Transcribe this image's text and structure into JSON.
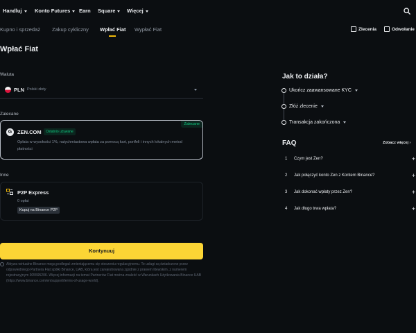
{
  "top_nav": {
    "items": [
      {
        "label": "Handluj",
        "has_caret": true
      },
      {
        "label": "Konto Futures",
        "has_caret": true
      },
      {
        "label": "Earn",
        "has_caret": false
      },
      {
        "label": "Square",
        "has_caret": true
      },
      {
        "label": "Więcej",
        "has_caret": true
      }
    ],
    "search_icon": "search-icon"
  },
  "sub_nav": {
    "tabs": [
      {
        "label": "Kupno i sprzedaż",
        "active": false
      },
      {
        "label": "Zakup cykliczny",
        "active": false
      },
      {
        "label": "Wpłać Fiat",
        "active": true
      },
      {
        "label": "Wypłać Fiat",
        "active": false
      }
    ],
    "orders_label": "Zlecenia",
    "refunds_label": "Odwołanie"
  },
  "page_title": "Wpłać Fiat",
  "currency_section": {
    "label": "Waluta",
    "selected_code": "PLN",
    "selected_name": "Polski złoty"
  },
  "recommended": {
    "label": "Zalecane",
    "name": "ZEN.COM",
    "badge": "Ostatnio używane",
    "tag": "Zalecane",
    "description": "Opłata w wysokości 1%, natychmiastowa wpłata za pomocą kart, portfeli i innych lokalnych metod płatności"
  },
  "other": {
    "label": "Inne",
    "name": "P2P Express",
    "fee": "0 opłat",
    "badge": "Kupuj na Binance P2P"
  },
  "continue_button": "Kontynuuj",
  "disclaimer": "Aktywa wirtualne Binance mogą podlegać zmieniającemu się otoczeniu regulacyjnemu. Te usługi są świadczone przez odpowiedniego Partnera Fiat spółki Binance, UAB, która jest zarejestrowana zgodnie z prawem litewskim, z numerem rejestracyjnym 305595206. Więcej informacji na temat Partnerów Fiat można znaleźć w Warunkach Użytkowania Binance UAB (https://www.binance.com/en/support/terms-of-usage-world).",
  "how_it_works": {
    "title": "Jak to działa?",
    "steps": [
      {
        "label": "Ukończ zaawansowane KYC"
      },
      {
        "label": "Złóż zlecenie"
      },
      {
        "label": "Transakcja zakończona"
      }
    ]
  },
  "faq": {
    "title": "FAQ",
    "more_label": "Zobacz więcej",
    "items": [
      {
        "num": "1",
        "question": "Czym jest Zen?"
      },
      {
        "num": "2",
        "question": "Jak połączyć konto Zen z Kontem Binance?"
      },
      {
        "num": "3",
        "question": "Jak dokonać wpłaty przez Zen?"
      },
      {
        "num": "4",
        "question": "Jak długo trwa wpłata?"
      }
    ]
  },
  "colors": {
    "background": "#0b0e11",
    "accent_yellow": "#fcd535",
    "badge_green": "#0ecb81",
    "muted_text": "#848e9c"
  }
}
